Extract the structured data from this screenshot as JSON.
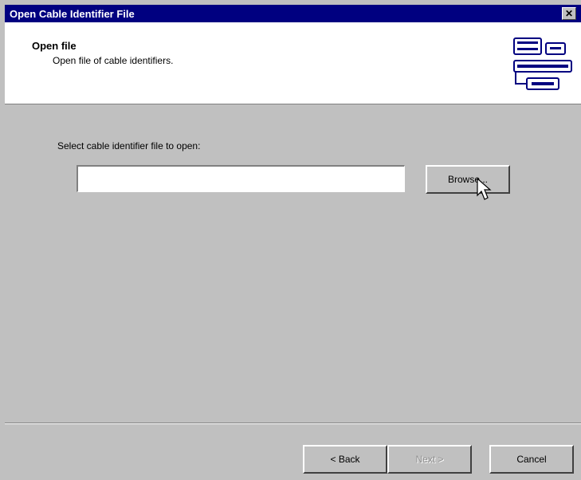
{
  "window": {
    "title": "Open Cable Identifier File",
    "close_label": "✕"
  },
  "header": {
    "title": "Open file",
    "subtitle": "Open file of cable identifiers.",
    "icon": "cable-identifier-icon"
  },
  "body": {
    "prompt": "Select cable identifier file to open:",
    "file_path_value": "",
    "browse_label": "Browse..."
  },
  "footer": {
    "back_label": "< Back",
    "next_label": "Next >",
    "next_enabled": false,
    "cancel_label": "Cancel"
  },
  "colors": {
    "title_bar": "#000080",
    "dialog_face": "#c0c0c0",
    "header_bg": "#ffffff"
  }
}
